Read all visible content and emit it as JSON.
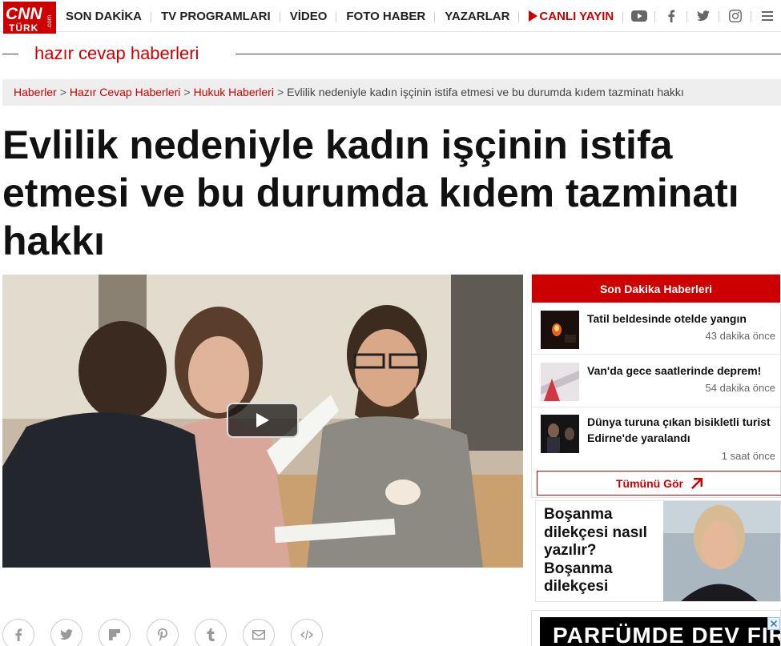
{
  "nav": {
    "logo": {
      "main": "CNN",
      "sub": "TÜRK",
      "com": ".com"
    },
    "items": [
      {
        "label": "SON DAKİKA"
      },
      {
        "label": "TV PROGRAMLARI"
      },
      {
        "label": "VİDEO"
      },
      {
        "label": "FOTO HABER"
      },
      {
        "label": "YAZARLAR"
      }
    ],
    "live_label": "CANLI YAYIN",
    "icons": [
      "youtube-icon",
      "facebook-icon",
      "twitter-icon",
      "instagram-icon",
      "menu-icon",
      "search-icon"
    ]
  },
  "section": {
    "title": "hazır cevap haberleri"
  },
  "breadcrumb": {
    "links": [
      "Haberler",
      "Hazır Cevap Haberleri",
      "Hukuk Haberleri"
    ],
    "current": "Evlilik nedeniyle kadın işçinin istifa etmesi ve bu durumda kıdem tazminatı hakkı",
    "separator": ">"
  },
  "article": {
    "headline": "Evlilik nedeniyle kadın işçinin istifa etmesi ve bu durumda kıdem tazminatı hakkı"
  },
  "share": {
    "icons": [
      "facebook-icon",
      "twitter-icon",
      "flipboard-icon",
      "pinterest-icon",
      "tumblr-icon",
      "mail-icon",
      "embed-icon"
    ]
  },
  "breaking": {
    "header": "Son Dakika Haberleri",
    "items": [
      {
        "title": "Tatil beldesinde otelde yangın",
        "time": "43 dakika önce"
      },
      {
        "title": "Van'da gece saatlerinde deprem!",
        "time": "54 dakika önce"
      },
      {
        "title": "Dünya turuna çıkan bisikletli turist Edirne'de yaralandı",
        "time": "1 saat önce"
      }
    ],
    "see_all": "Tümünü Gör"
  },
  "promo": {
    "title": "Boşanma dilekçesi nasıl yazılır? Boşanma dilekçesi"
  },
  "ad": {
    "text": "PARFÜMDE DEV FIRSAT"
  }
}
